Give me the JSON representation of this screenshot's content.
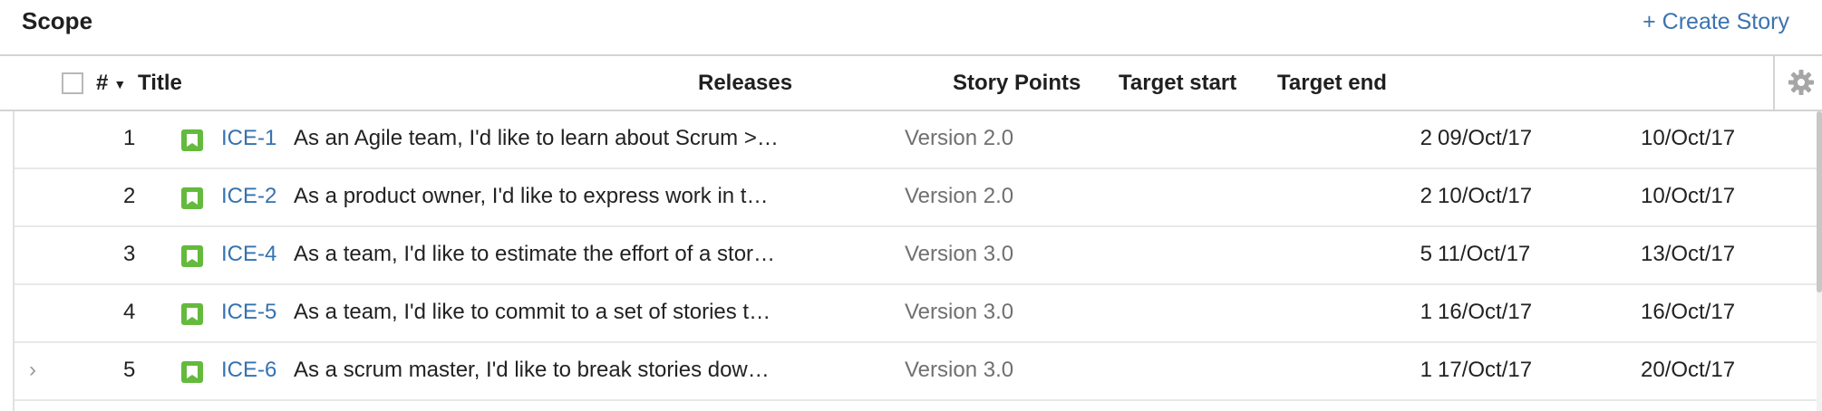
{
  "header": {
    "title": "Scope",
    "create_story": "+ Create Story"
  },
  "columns": {
    "rank": "#",
    "title": "Title",
    "releases": "Releases",
    "story_points": "Story Points",
    "target_start": "Target start",
    "target_end": "Target end"
  },
  "rows": [
    {
      "rank": "1",
      "key": "ICE-1",
      "title": "As an Agile team, I'd like to learn about Scrum >…",
      "release": "Version 2.0",
      "points": "2",
      "start": "09/Oct/17",
      "end": "10/Oct/17"
    },
    {
      "rank": "2",
      "key": "ICE-2",
      "title": "As a product owner, I'd like to express work in t…",
      "release": "Version 2.0",
      "points": "2",
      "start": "10/Oct/17",
      "end": "10/Oct/17"
    },
    {
      "rank": "3",
      "key": "ICE-4",
      "title": "As a team, I'd like to estimate the effort of a stor…",
      "release": "Version 3.0",
      "points": "5",
      "start": "11/Oct/17",
      "end": "13/Oct/17"
    },
    {
      "rank": "4",
      "key": "ICE-5",
      "title": "As a team, I'd like to commit to a set of stories t…",
      "release": "Version 3.0",
      "points": "1",
      "start": "16/Oct/17",
      "end": "16/Oct/17"
    },
    {
      "rank": "5",
      "key": "ICE-6",
      "title": "As a scrum master, I'd like to break stories dow…",
      "release": "Version 3.0",
      "points": "1",
      "start": "17/Oct/17",
      "end": "20/Oct/17"
    }
  ],
  "icons": {
    "story": "story-icon",
    "settings": "gear-icon",
    "expand": "chevron-right-icon",
    "sort": "caret-down-icon"
  },
  "colors": {
    "link": "#3572b0",
    "story_icon": "#63ba3c",
    "muted_text": "#707070"
  }
}
